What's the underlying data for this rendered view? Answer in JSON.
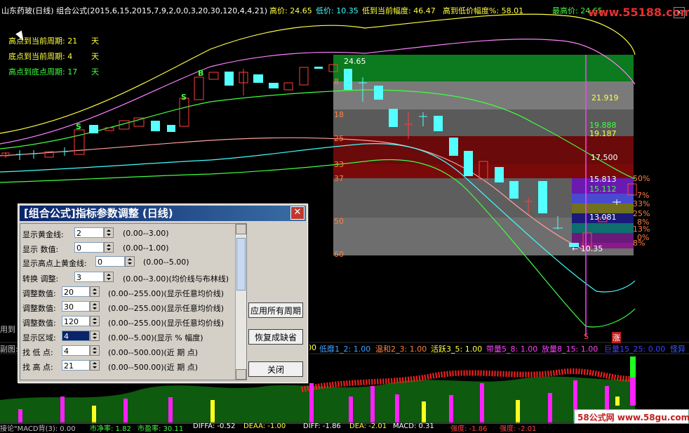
{
  "header": {
    "title": "山东药玻(日线) 组合公式(2015,6,15,2015,7,9,2,0,0,3,20,30,120,4,4,21)",
    "high_label": "高价: 24.65",
    "low_label": "低价: 10.35",
    "low_to_now": "低到当前幅度: 46.47",
    "high_to_low": "高到低价幅度%: 58.01",
    "highest_price": "最高价: 24.65",
    "watermark": "www.55188.com"
  },
  "side_labels": {
    "l1_text": "高点到当前周期: 21",
    "l1_unit": "天",
    "l2_text": "底点到当前周期: 4",
    "l2_unit": "天",
    "l3_text": "高点到底点周期: 17",
    "l3_unit": "天"
  },
  "chart": {
    "price_high": "24.65",
    "price_low": "← 10.35",
    "levels": [
      "21.919",
      "19.888",
      "19.187",
      "17.500",
      "15.813",
      "15.112",
      "13.081"
    ],
    "fib_labels": [
      "8",
      "18",
      "25",
      "33",
      "37",
      "50",
      "60"
    ],
    "pct_labels": [
      "50%",
      "7%",
      "33%",
      "25%",
      "8%",
      "13%",
      "0%",
      "8%"
    ],
    "markers": {
      "s1": "S",
      "s2": "S",
      "b1": "B"
    },
    "volume_marks": {
      "m1": "S",
      "m2": "涨"
    }
  },
  "dialog": {
    "title": "[组合公式]指标参数调整 (日线)",
    "close": "✕",
    "rows": [
      {
        "label": "显示黄金线:",
        "value": "2",
        "range": "(0.00--3.00)"
      },
      {
        "label": "显示  数值:",
        "value": "0",
        "range": "(0.00--1.00)"
      },
      {
        "label": "显示高点上黄金线:",
        "value": "0",
        "range": "(0.00--5.00)"
      },
      {
        "label": "转换  调整:",
        "value": "3",
        "range": "(0.00--3.00)(均价线与布林线)"
      },
      {
        "label": "调整数值:",
        "value": "20",
        "range": "(0.00--255.00)(显示任意均价线)"
      },
      {
        "label": "调整数值:",
        "value": "30",
        "range": "(0.00--255.00)(显示任意均价线)"
      },
      {
        "label": "调整数值:",
        "value": "120",
        "range": "(0.00--255.00)(显示任意均价线)"
      },
      {
        "label": "显示区域:",
        "value": "4",
        "range": "(0.00--5.00)(显示 % 幅度)"
      },
      {
        "label": "找 低 点:",
        "value": "4",
        "range": "(0.00--500.00)(近 期 点)"
      },
      {
        "label": "找 高 点:",
        "value": "21",
        "range": "(0.00--500.00)(近 期 点)"
      }
    ],
    "apply_all": "应用所有周期",
    "restore": "恢复成缺省",
    "close_btn": "关闭"
  },
  "indicator_bar": {
    "left1": "用到",
    "left2": "副图:",
    "items": [
      "00",
      "低靡1_2: 1.00",
      "温和2_3: 1.00",
      "活跃3_5: 1.00",
      "带量5_8: 1.00",
      "放量8_15: 1.00",
      "巨量15_25: 0.00",
      "怪异"
    ]
  },
  "bottom_bar": {
    "items": [
      "接论\"MACD背(3): 0.00",
      "市净率: 1.82",
      "市盈率: 30.11",
      "DIFFA: -0.52",
      "DEAA: -1.00",
      "DIFF: -1.86",
      "DEA: -2.01",
      "MACD: 0.31",
      "强度: -1.86",
      "强度: -2.01"
    ],
    "watermark": "58公式网 www.58gu.com"
  },
  "colors": {
    "bg": "#000000",
    "up": "#ff3232",
    "down": "#54ffff",
    "title_bar": "#0a246a"
  }
}
